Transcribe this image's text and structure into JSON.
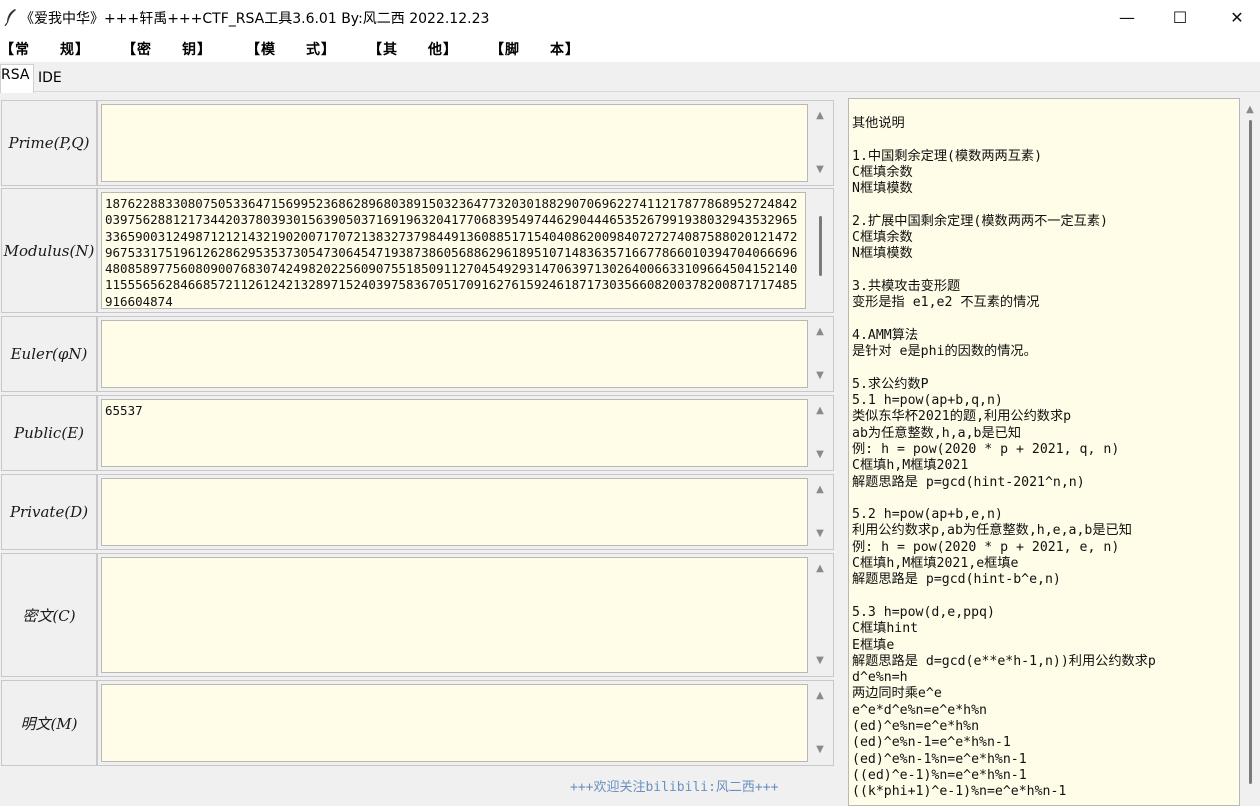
{
  "window": {
    "title": "《爱我中华》+++轩禹+++CTF_RSA工具3.6.01   By:风二西 2022.12.23",
    "minimize": "—",
    "maximize": "☐",
    "close": "✕"
  },
  "menu": {
    "items": [
      "【常　　规】",
      "【密　　钥】",
      "【模　　式】",
      "【其　　他】",
      "【脚　　本】"
    ]
  },
  "tabs": {
    "items": [
      "RSA",
      "IDE"
    ],
    "active": "RSA"
  },
  "fields": {
    "prime": {
      "label": "Prime(P,Q)",
      "value": ""
    },
    "modulus": {
      "label": "Modulus(N)",
      "value": "187622883308075053364715699523686289680389150323647732030188290706962274112178778689527248420397562881217344203780393015639050371691963204177068395497446290444653526799193803294353296533659003124987121214321902007170721383273798449136088517154040862009840727274087588020121472967533175196126286295353730547306454719387386056886296189510714836357166778660103947040666964808589775608090076830742498202256090755185091127045492931470639713026400663310966450415214011555656284668572112612421328971524039758367051709162761592461871730356608200378200871717485916604874"
    },
    "euler": {
      "label": "Euler(φN)",
      "value": ""
    },
    "public": {
      "label": "Public(E)",
      "value": "65537"
    },
    "private": {
      "label": "Private(D)",
      "value": ""
    },
    "ciphertext": {
      "label": "密文(C)",
      "value": ""
    },
    "plaintext": {
      "label": "明文(M)",
      "value": ""
    }
  },
  "footer": {
    "text": "+++欢迎关注bilibili:风二西+++"
  },
  "notes": {
    "text": "其他说明\n\n1.中国剩余定理(模数两两互素)\nC框填余数\nN框填模数\n\n2.扩展中国剩余定理(模数两两不一定互素)\nC框填余数\nN框填模数\n\n3.共模攻击变形题\n变形是指 e1,e2 不互素的情况\n\n4.AMM算法\n是针对 e是phi的因数的情况。\n\n5.求公约数P\n5.1 h=pow(ap+b,q,n)\n类似东华杯2021的题,利用公约数求p\nab为任意整数,h,a,b是已知\n例: h = pow(2020 * p + 2021, q, n)\nC框填h,M框填2021\n解题思路是 p=gcd(hint-2021^n,n)\n\n5.2 h=pow(ap+b,e,n)\n利用公约数求p,ab为任意整数,h,e,a,b是已知\n例: h = pow(2020 * p + 2021, e, n)\nC框填h,M框填2021,e框填e\n解题思路是 p=gcd(hint-b^e,n)\n\n5.3 h=pow(d,e,ppq)\nC框填hint\nE框填e\n解题思路是 d=gcd(e**e*h-1,n))利用公约数求p\nd^e%n=h\n两边同时乘e^e\ne^e*d^e%n=e^e*h%n\n(ed)^e%n=e^e*h%n\n(ed)^e%n-1=e^e*h%n-1\n(ed)^e%n-1%n=e^e*h%n-1\n((ed)^e-1)%n=e^e*h%n-1\n((k*phi+1)^e-1)%n=e^e*h%n-1"
  }
}
